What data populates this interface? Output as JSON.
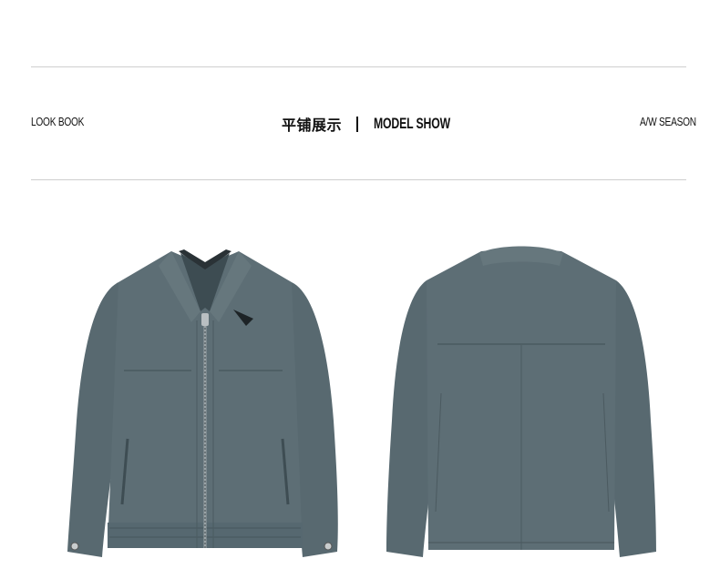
{
  "header": {
    "left_label": "LOOK BOOK",
    "center_cn": "平铺展示",
    "center_en": "MODEL SHOW",
    "right_label": "A/W SEASON"
  },
  "product": {
    "jacket_color": "#5b6b71",
    "jacket_shadow": "#46555b",
    "collar_lining": "#222a2e"
  }
}
